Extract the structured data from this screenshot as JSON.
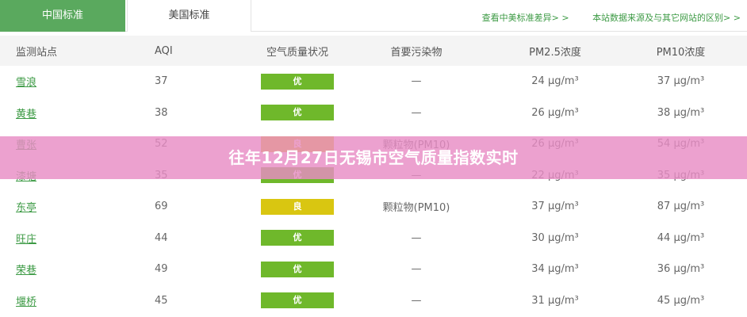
{
  "tabs": [
    {
      "label": "中国标准",
      "active": true
    },
    {
      "label": "美国标准",
      "active": false
    }
  ],
  "links": {
    "diff": "查看中美标准差异> >",
    "source": "本站数据来源及与其它网站的区别> >"
  },
  "table": {
    "headers": [
      "监测站点",
      "AQI",
      "空气质量状况",
      "首要污染物",
      "PM2.5浓度",
      "PM10浓度"
    ],
    "rows": [
      {
        "station": "雪浪",
        "aqi": "37",
        "quality": "优",
        "level": "good",
        "pollutant": "—",
        "pm25": "24 μg/m³",
        "pm10": "37 μg/m³"
      },
      {
        "station": "黄巷",
        "aqi": "38",
        "quality": "优",
        "level": "good",
        "pollutant": "—",
        "pm25": "26 μg/m³",
        "pm10": "38 μg/m³"
      },
      {
        "station": "曹张",
        "aqi": "52",
        "quality": "良",
        "level": "moderate",
        "pollutant": "颗粒物(PM10)",
        "pm25": "26 μg/m³",
        "pm10": "54 μg/m³"
      },
      {
        "station": "漆塘",
        "aqi": "35",
        "quality": "优",
        "level": "good",
        "pollutant": "—",
        "pm25": "22 μg/m³",
        "pm10": "35 μg/m³"
      },
      {
        "station": "东亭",
        "aqi": "69",
        "quality": "良",
        "level": "moderate",
        "pollutant": "颗粒物(PM10)",
        "pm25": "37 μg/m³",
        "pm10": "87 μg/m³"
      },
      {
        "station": "旺庄",
        "aqi": "44",
        "quality": "优",
        "level": "good",
        "pollutant": "—",
        "pm25": "30 μg/m³",
        "pm10": "44 μg/m³"
      },
      {
        "station": "荣巷",
        "aqi": "49",
        "quality": "优",
        "level": "good",
        "pollutant": "—",
        "pm25": "34 μg/m³",
        "pm10": "36 μg/m³"
      },
      {
        "station": "堰桥",
        "aqi": "45",
        "quality": "优",
        "level": "good",
        "pollutant": "—",
        "pm25": "31 μg/m³",
        "pm10": "45 μg/m³"
      }
    ]
  },
  "overlay": {
    "title": "往年12月27日无锡市空气质量指数实时"
  },
  "colors": {
    "accent": "#5aa95e",
    "good": "#6fb82b",
    "moderate": "#d9c611",
    "overlay": "#e88cc4"
  }
}
